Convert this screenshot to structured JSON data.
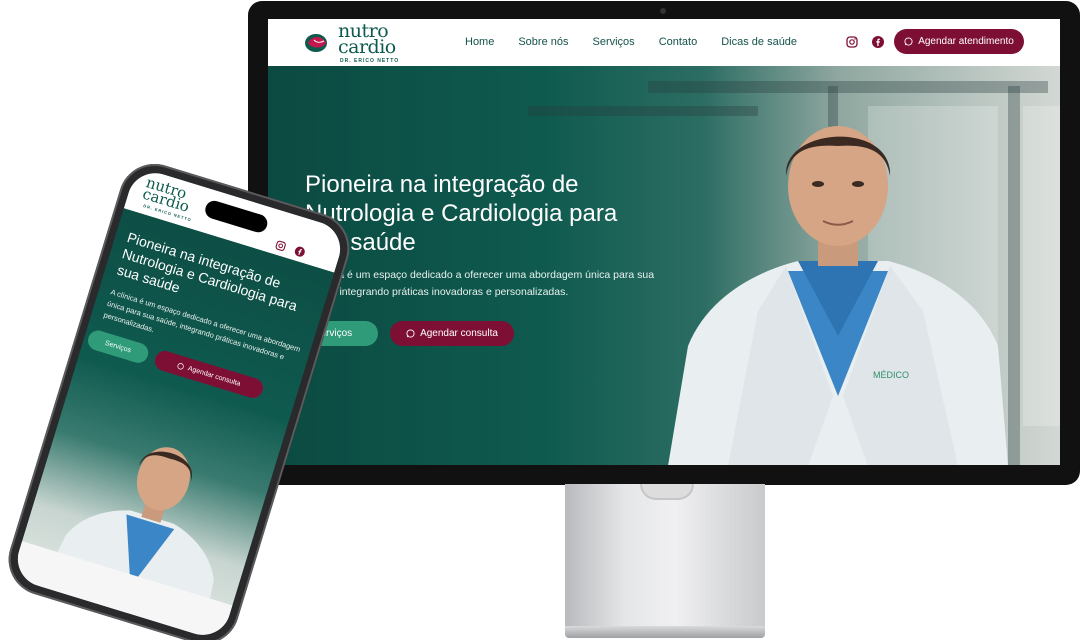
{
  "desktop": {
    "logo": {
      "line1": "nutro",
      "line2": "cardio",
      "sub": "DR. ERICO NETTO"
    },
    "nav": [
      "Home",
      "Sobre nós",
      "Serviços",
      "Contato",
      "Dicas de saúde"
    ],
    "social": [
      "instagram-icon",
      "facebook-icon"
    ],
    "cta": "Agendar atendimento",
    "hero": {
      "title": "Pioneira na integração de Nutrologia e Cardiologia para sua saúde",
      "description": "A clínica é um espaço dedicado a oferecer uma abordagem única para sua saúde, integrando práticas inovadoras e personalizadas.",
      "btn_services": "Serviços",
      "btn_consult": "Agendar consulta"
    },
    "coat_label": "MÉDICO"
  },
  "phone": {
    "logo": {
      "line1": "nutro",
      "line2": "cardio",
      "sub": "DR. ERICO NETTO"
    },
    "hero": {
      "title": "Pioneira na integração de Nutrologia e Cardiologia para sua saúde",
      "description": "A clínica é um espaço dedicado a oferecer uma abordagem única para sua saúde, integrando práticas inovadoras e personalizadas.",
      "btn_services": "Serviços",
      "btn_consult": "Agendar consulta"
    }
  },
  "colors": {
    "brand_green": "#0e5b4e",
    "accent_wine": "#7e0f34",
    "button_green": "#2f9b78"
  }
}
